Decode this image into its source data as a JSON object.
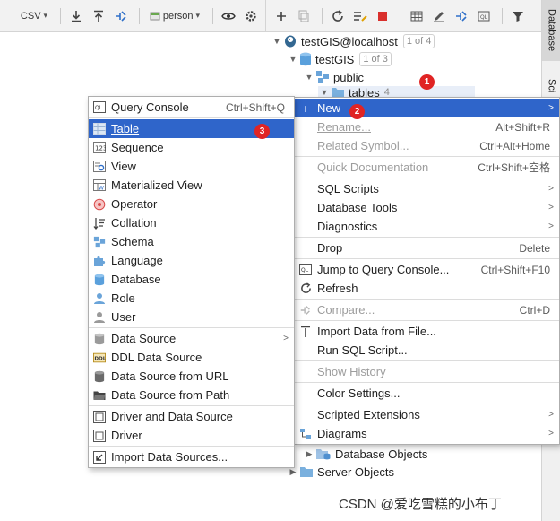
{
  "left_toolbar": {
    "csv_label": "CSV"
  },
  "right_toolbar": {
    "person_label": "person"
  },
  "side_strip": {
    "database_tab": "Database",
    "sci_tab": "Sci"
  },
  "tree": {
    "connection": {
      "label": "testGIS@localhost",
      "count": "1 of 4"
    },
    "database": {
      "label": "testGIS",
      "count": "1 of 3"
    },
    "schema": {
      "label": "public"
    },
    "tables": {
      "label": "tables",
      "count": "4"
    },
    "database_objects": {
      "label": "Database Objects"
    },
    "server_objects": {
      "label": "Server Objects"
    }
  },
  "context_menu": {
    "new": {
      "label": "New"
    },
    "rename": {
      "label": "Rename...",
      "shortcut": "Alt+Shift+R"
    },
    "related_symbol": {
      "label": "Related Symbol...",
      "shortcut": "Ctrl+Alt+Home"
    },
    "quick_doc": {
      "label": "Quick Documentation",
      "shortcut": "Ctrl+Shift+空格"
    },
    "sql_scripts": {
      "label": "SQL Scripts"
    },
    "database_tools": {
      "label": "Database Tools"
    },
    "diagnostics": {
      "label": "Diagnostics"
    },
    "drop": {
      "label": "Drop",
      "shortcut": "Delete"
    },
    "jump_console": {
      "label": "Jump to Query Console...",
      "shortcut": "Ctrl+Shift+F10"
    },
    "refresh": {
      "label": "Refresh"
    },
    "compare": {
      "label": "Compare...",
      "shortcut": "Ctrl+D"
    },
    "import_file": {
      "label": "Import Data from File..."
    },
    "run_sql": {
      "label": "Run SQL Script..."
    },
    "show_history": {
      "label": "Show History"
    },
    "color_settings": {
      "label": "Color Settings..."
    },
    "scripted_ext": {
      "label": "Scripted Extensions"
    },
    "diagrams": {
      "label": "Diagrams"
    }
  },
  "new_submenu": {
    "query_console": {
      "label": "Query Console",
      "shortcut": "Ctrl+Shift+Q"
    },
    "table": {
      "label": "Table"
    },
    "sequence": {
      "label": "Sequence"
    },
    "view": {
      "label": "View"
    },
    "mat_view": {
      "label": "Materialized View"
    },
    "operator": {
      "label": "Operator"
    },
    "collation": {
      "label": "Collation"
    },
    "schema": {
      "label": "Schema"
    },
    "language": {
      "label": "Language"
    },
    "database": {
      "label": "Database"
    },
    "role": {
      "label": "Role"
    },
    "user": {
      "label": "User"
    },
    "data_source": {
      "label": "Data Source"
    },
    "ddl_data_source": {
      "label": "DDL Data Source"
    },
    "ds_from_url": {
      "label": "Data Source from URL"
    },
    "ds_from_path": {
      "label": "Data Source from Path"
    },
    "driver_and_ds": {
      "label": "Driver and Data Source"
    },
    "driver": {
      "label": "Driver"
    },
    "import_ds": {
      "label": "Import Data Sources..."
    }
  },
  "badges": {
    "one": "1",
    "two": "2",
    "three": "3"
  },
  "watermark": "CSDN @爱吃雪糕的小布丁",
  "colors": {
    "selection": "#2f65ca",
    "badge": "#e02424"
  }
}
